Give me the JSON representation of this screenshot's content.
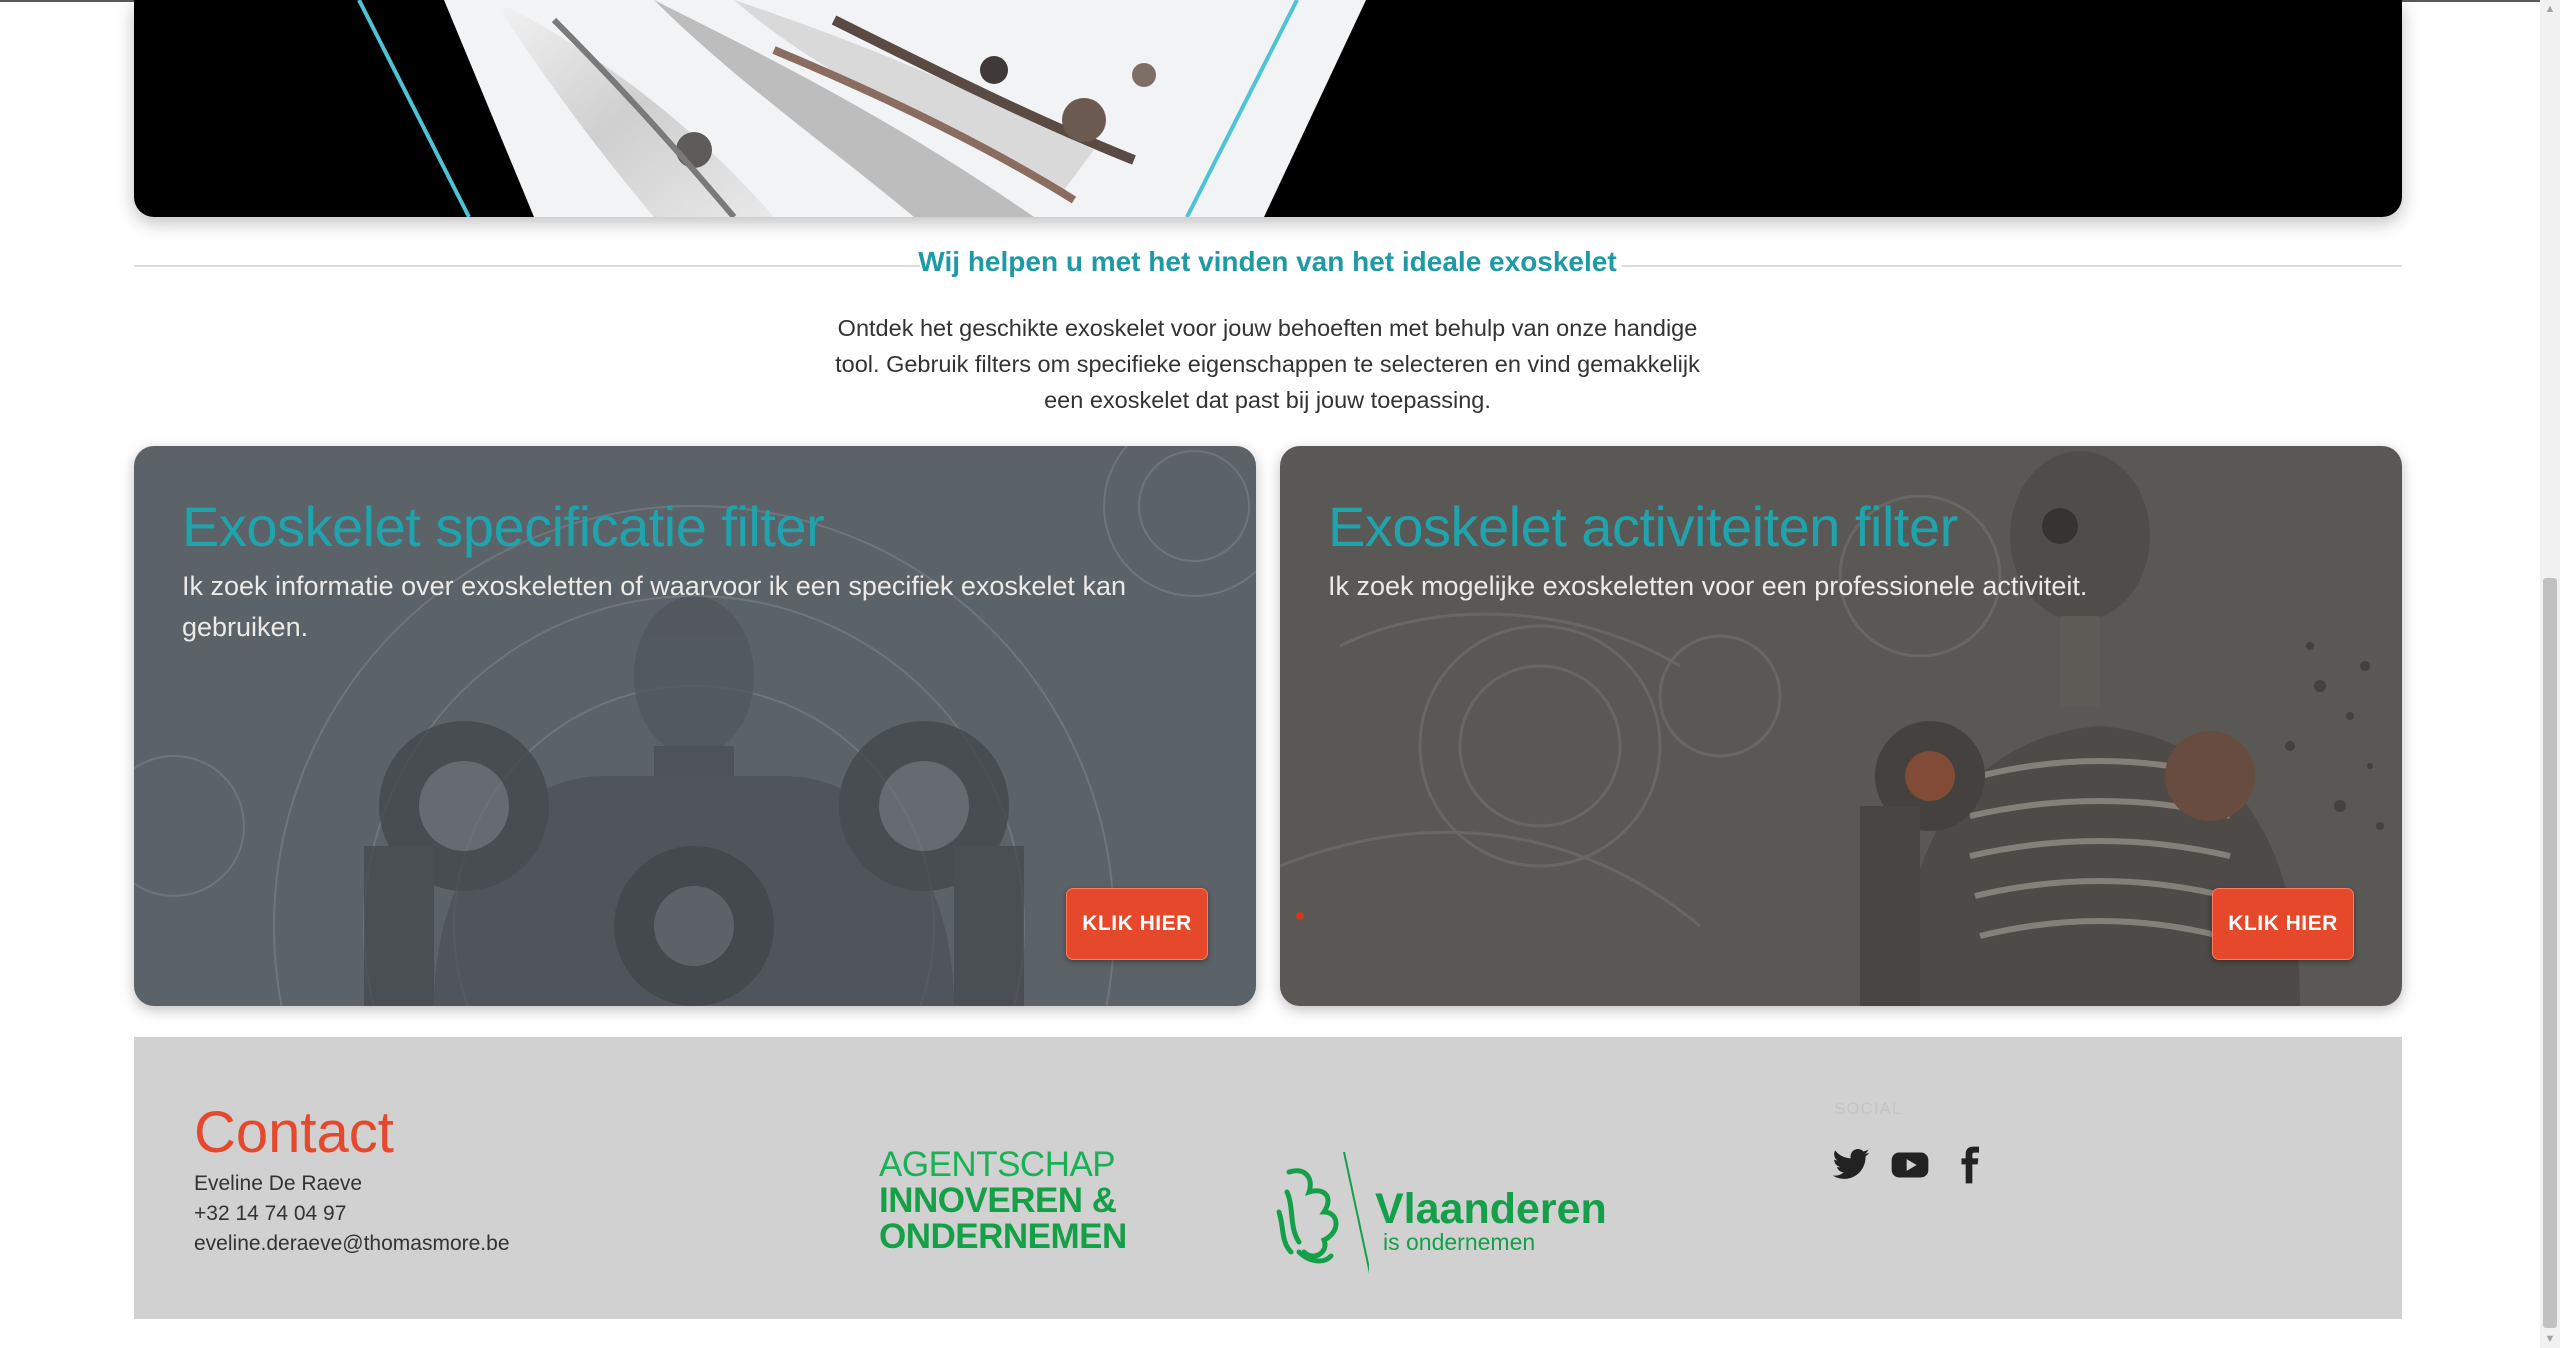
{
  "colors": {
    "accent": "#1fa4ad",
    "brand_orange": "#e5482b",
    "vlaanderen_green": "#13a048",
    "footer_bg": "#d1d1d1"
  },
  "section": {
    "heading": "Wij helpen u met het vinden van het ideale exoskelet",
    "intro": "Ontdek het geschikte exoskelet voor jouw behoeften met behulp van onze handige tool. Gebruik filters om specifieke eigenschappen te selecteren en vind gemakkelijk een exoskelet dat past bij jouw toepassing."
  },
  "cards": [
    {
      "title": "Exoskelet specificatie filter",
      "description": "Ik zoek informatie over exoskeletten of waarvoor ik een specifiek exoskelet kan gebruiken.",
      "button_label": "KLIK HIER"
    },
    {
      "title": "Exoskelet activiteiten filter",
      "description": "Ik zoek mogelijke exoskeletten voor een professionele activiteit.",
      "button_label": "KLIK HIER"
    }
  ],
  "footer": {
    "contact_title": "Contact",
    "contact_name": "Eveline De Raeve",
    "contact_phone": "+32 14 74 04 97",
    "contact_email": "eveline.deraeve@thomasmore.be",
    "logo": {
      "agency_line1": "AGENTSCHAP",
      "agency_line2": "INNOVEREN &",
      "agency_line3": "ONDERNEMEN",
      "region": "Vlaanderen",
      "tagline": "is ondernemen"
    },
    "social_heading": "SOCIAL",
    "social_icons": [
      "twitter-icon",
      "youtube-icon",
      "facebook-icon"
    ]
  }
}
